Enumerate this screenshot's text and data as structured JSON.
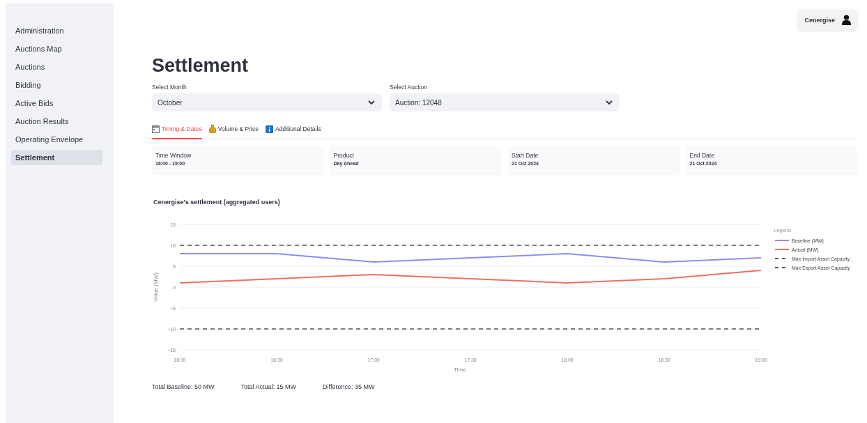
{
  "sidebar": {
    "items": [
      {
        "label": "Administration",
        "selected": false
      },
      {
        "label": "Auctions Map",
        "selected": false
      },
      {
        "label": "Auctions",
        "selected": false
      },
      {
        "label": "Bidding",
        "selected": false
      },
      {
        "label": "Active Bids",
        "selected": false
      },
      {
        "label": "Auction Results",
        "selected": false
      },
      {
        "label": "Operating Envelope",
        "selected": false
      },
      {
        "label": "Settlement",
        "selected": true
      }
    ]
  },
  "user": {
    "name": "Cenergise"
  },
  "title": "Settlement",
  "selects": [
    {
      "label": "Select Month",
      "value": "October"
    },
    {
      "label": "Select Auction",
      "value": "Auction: 12048"
    }
  ],
  "tabs": [
    {
      "label": "Timing & Dates",
      "selected": true
    },
    {
      "label": "Volume & Price",
      "selected": false
    },
    {
      "label": "Additional Details",
      "selected": false
    }
  ],
  "metrics": [
    {
      "label": "Time Window",
      "value": "16:00 - 19:00"
    },
    {
      "label": "Product",
      "value": "Day Ahead"
    },
    {
      "label": "Start Date",
      "value": "21 Oct 2024"
    },
    {
      "label": "End Date",
      "value": "21 Oct 2024"
    }
  ],
  "chart_title": "Cenergise's settlement (aggregated users)",
  "chart_data": {
    "type": "line",
    "xlabel": "Time",
    "ylabel": "Value (MW)",
    "legend": {
      "title": "Legend"
    },
    "grid": true,
    "x": [
      "16:00",
      "16:30",
      "17:00",
      "17:30",
      "18:00",
      "18:30",
      "19:00"
    ],
    "ylim": [
      -15,
      15
    ],
    "yticks": [
      -15,
      -10,
      -5,
      0,
      5,
      10,
      15
    ],
    "series": [
      {
        "name": "Baseline (MW)",
        "color": "#8c8cf8",
        "line_style": "solid",
        "values": [
          8,
          8,
          6,
          7,
          8,
          6,
          7
        ]
      },
      {
        "name": "Actual (MW)",
        "color": "#f0705e",
        "line_style": "solid",
        "values": [
          1,
          2,
          3,
          2,
          1,
          2,
          4
        ]
      },
      {
        "name": "Max Import Asset Capacity",
        "color": "#555555",
        "line_style": "dashed",
        "values": [
          10,
          10,
          10,
          10,
          10,
          10,
          10
        ]
      },
      {
        "name": "Max Export Asset Capacity",
        "color": "#555555",
        "line_style": "dashed",
        "values": [
          -10,
          -10,
          -10,
          -10,
          -10,
          -10,
          -10
        ]
      }
    ]
  },
  "totals": [
    "Total Baseline: 50 MW",
    "Total Actual: 15 MW",
    "Difference: 35 MW"
  ]
}
